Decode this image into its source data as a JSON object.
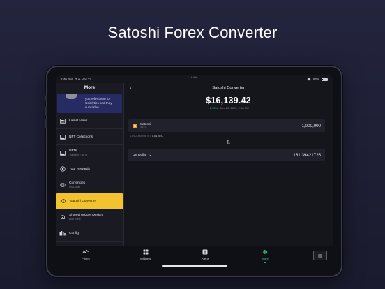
{
  "headline": "Satoshi Forex Converter",
  "statusbar": {
    "time": "2:40 PM",
    "date": "Tue Nov 22",
    "battery": "82%"
  },
  "sidebar": {
    "title": "More",
    "promo_text": "you refer them to Coinlytics and they subscribe.",
    "items": [
      {
        "label": "Latest News",
        "sub": "",
        "icon": "news-icon"
      },
      {
        "label": "NFT Collections",
        "sub": "",
        "icon": "image-icon"
      },
      {
        "label": "NFTs",
        "sub": "Tracking 2 NFTs",
        "icon": "image-icon"
      },
      {
        "label": "Your Rewards",
        "sub": "",
        "icon": "rewards-icon"
      },
      {
        "label": "Currencies",
        "sub": "US Dollar",
        "icon": "currencies-icon"
      },
      {
        "label": "Satoshi Converter",
        "sub": "",
        "icon": "satoshi-icon",
        "active": true
      },
      {
        "label": "Shared Widget Design",
        "sub": "Blue Steel",
        "icon": "widget-design-icon"
      },
      {
        "label": "Config",
        "sub": "",
        "icon": "config-icon"
      }
    ]
  },
  "main": {
    "title": "Satoshi Converter",
    "price": "$16,139.42",
    "change_pct": "+2.76%",
    "change_date": "- Nov 22, 2022, 2:38 PM",
    "from": {
      "name": "Satoshi",
      "ticker": "SATS",
      "value": "1,000,000"
    },
    "ratio_prefix": "1,000,000 SATS =",
    "ratio_value": "0.01 BTC",
    "to": {
      "currency": "US Dollar",
      "value": "161.39421726"
    }
  },
  "tabbar": {
    "tabs": [
      {
        "label": "Prices",
        "icon": "prices-icon"
      },
      {
        "label": "Widgets",
        "icon": "widgets-icon"
      },
      {
        "label": "Alerts",
        "icon": "alerts-icon"
      },
      {
        "label": "More",
        "icon": "gear-icon",
        "active": true
      }
    ]
  },
  "colors": {
    "accent": "#f2c230",
    "positive": "#3fd08a",
    "promo": "#272b64"
  }
}
